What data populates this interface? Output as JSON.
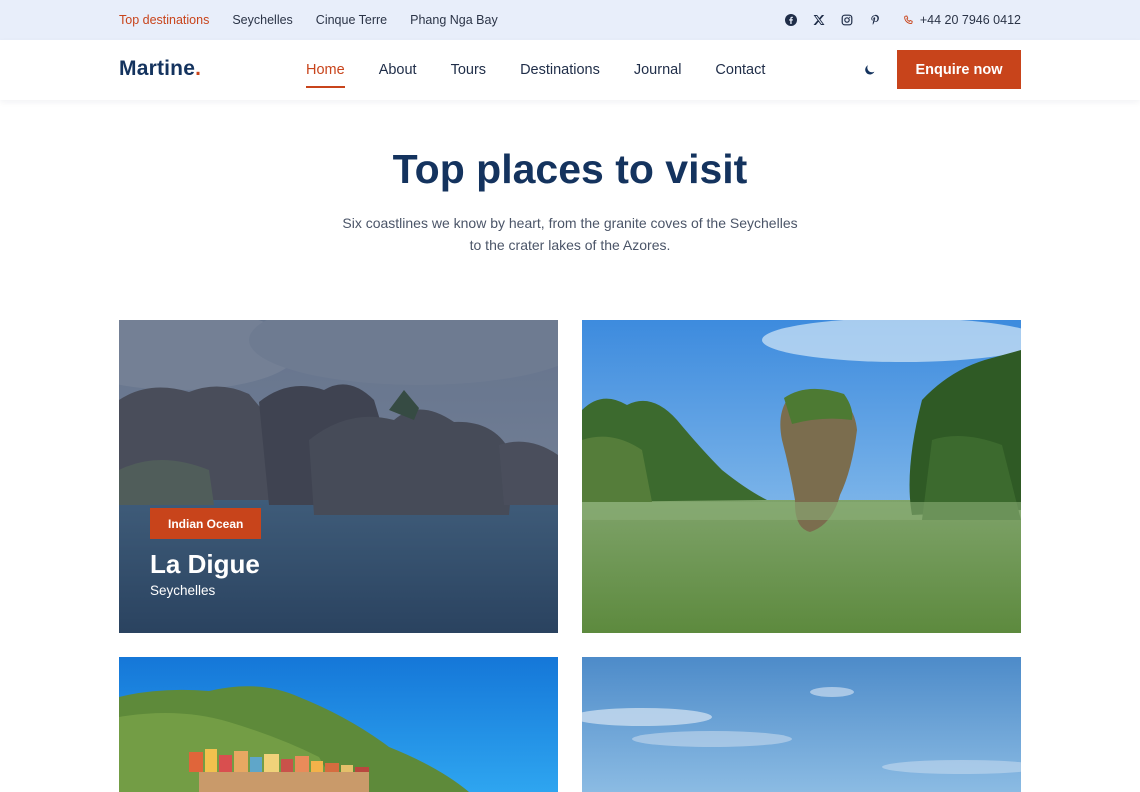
{
  "topbar": {
    "links": [
      {
        "label": "Top destinations",
        "active": true
      },
      {
        "label": "Seychelles",
        "active": false
      },
      {
        "label": "Cinque Terre",
        "active": false
      },
      {
        "label": "Phang Nga Bay",
        "active": false
      }
    ],
    "social_icons": [
      "facebook-icon",
      "x-icon",
      "instagram-icon",
      "pinterest-icon"
    ],
    "phone": "+44 20 7946 0412"
  },
  "header": {
    "logo": "Martine",
    "logo_dot": ".",
    "nav": [
      "Home",
      "About",
      "Tours",
      "Destinations",
      "Journal",
      "Contact"
    ],
    "active_nav": "Home",
    "theme_icon": "moon-icon",
    "cta": "Enquire now"
  },
  "hero": {
    "title": "Top places to visit",
    "subtitle": "Six coastlines we know by heart, from the granite coves of the Seychelles to the crater lakes of the Azores."
  },
  "cards": [
    {
      "badge": "Indian Ocean",
      "title": "La Digue",
      "country": "Seychelles",
      "hovered": true
    },
    {
      "badge": "",
      "title": "",
      "country": "",
      "hovered": false
    },
    {
      "badge": "",
      "title": "",
      "country": "",
      "hovered": false
    },
    {
      "badge": "",
      "title": "",
      "country": "",
      "hovered": false
    }
  ],
  "colors": {
    "accent": "#c8441b",
    "navy": "#14335e",
    "topbar_bg": "#e8eefa"
  }
}
